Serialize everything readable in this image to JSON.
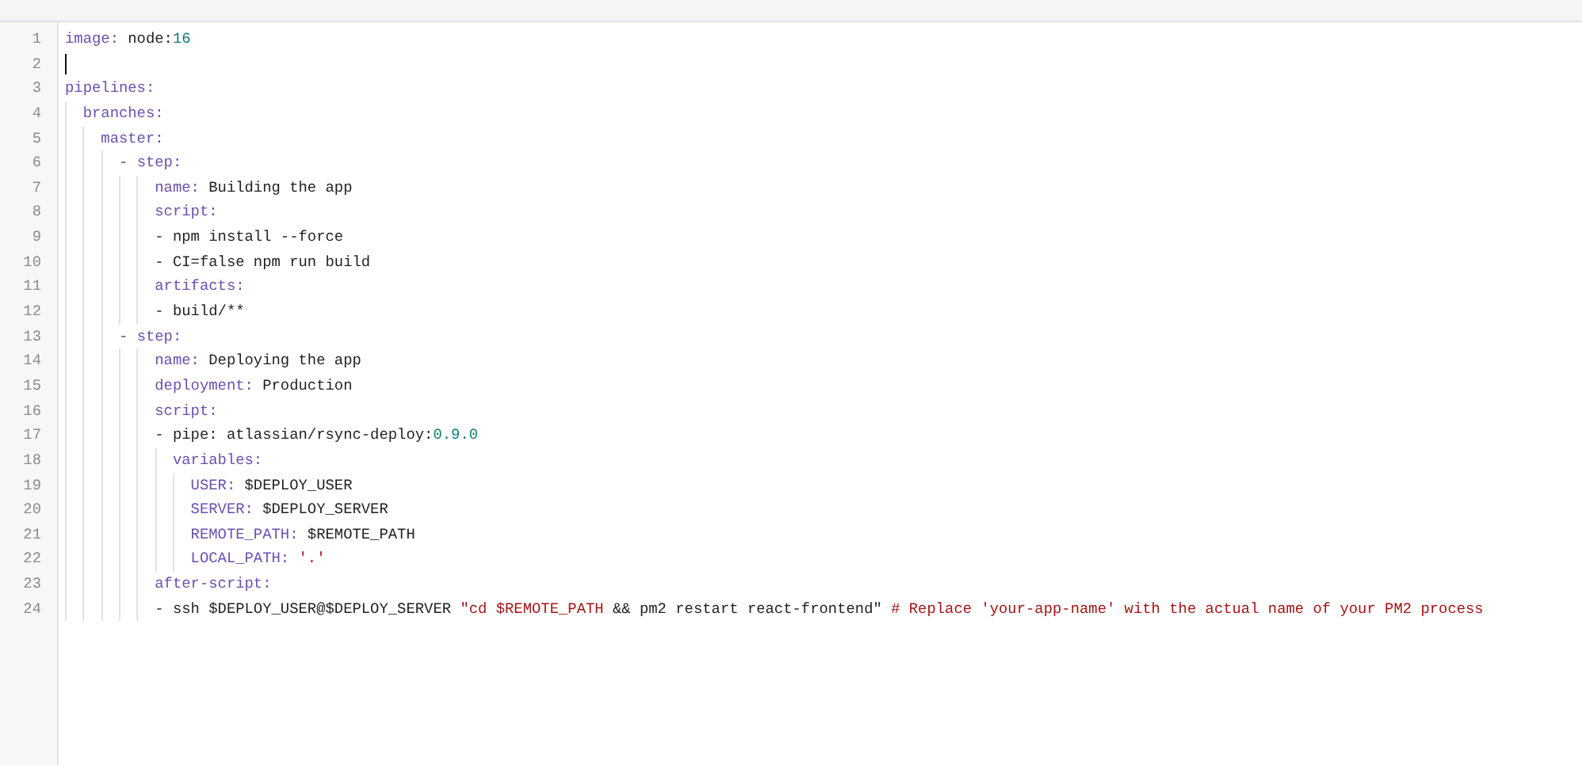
{
  "editor": {
    "lines": [
      {
        "number": "1",
        "cursor": false,
        "tokens": [
          {
            "kind": "key",
            "text": "image:"
          },
          {
            "kind": "plain",
            "text": " node:"
          },
          {
            "kind": "number",
            "text": "16"
          }
        ]
      },
      {
        "number": "2",
        "cursor": true
      },
      {
        "number": "3",
        "cursor": false,
        "tokens": [
          {
            "kind": "key",
            "text": "pipelines:"
          }
        ]
      },
      {
        "number": "4",
        "cursor": false,
        "tokens": [
          {
            "kind": "key",
            "text": "  branches:"
          }
        ]
      },
      {
        "number": "5",
        "cursor": false,
        "tokens": [
          {
            "kind": "key",
            "text": "    master:"
          }
        ]
      },
      {
        "number": "6",
        "cursor": false,
        "tokens": [
          {
            "kind": "punct",
            "text": "      - "
          },
          {
            "kind": "key",
            "text": "step:"
          }
        ]
      },
      {
        "number": "7",
        "cursor": false,
        "tokens": [
          {
            "kind": "key",
            "text": "          name:"
          },
          {
            "kind": "plain",
            "text": " Building the app"
          }
        ]
      },
      {
        "number": "8",
        "cursor": false,
        "tokens": [
          {
            "kind": "key",
            "text": "          script:"
          }
        ]
      },
      {
        "number": "9",
        "cursor": false,
        "tokens": [
          {
            "kind": "plain",
            "text": "          - npm install --force"
          }
        ]
      },
      {
        "number": "10",
        "cursor": false,
        "tokens": [
          {
            "kind": "plain",
            "text": "          - CI=false npm run build"
          }
        ]
      },
      {
        "number": "11",
        "cursor": false,
        "tokens": [
          {
            "kind": "key",
            "text": "          artifacts:"
          }
        ]
      },
      {
        "number": "12",
        "cursor": false,
        "tokens": [
          {
            "kind": "plain",
            "text": "          - build/**"
          }
        ]
      },
      {
        "number": "13",
        "cursor": false,
        "tokens": [
          {
            "kind": "punct",
            "text": "      - "
          },
          {
            "kind": "key",
            "text": "step:"
          }
        ]
      },
      {
        "number": "14",
        "cursor": false,
        "tokens": [
          {
            "kind": "key",
            "text": "          name:"
          },
          {
            "kind": "plain",
            "text": " Deploying the app"
          }
        ]
      },
      {
        "number": "15",
        "cursor": false,
        "tokens": [
          {
            "kind": "key",
            "text": "          deployment:"
          },
          {
            "kind": "plain",
            "text": " Production"
          }
        ]
      },
      {
        "number": "16",
        "cursor": false,
        "tokens": [
          {
            "kind": "key",
            "text": "          script:"
          }
        ]
      },
      {
        "number": "17",
        "cursor": false,
        "tokens": [
          {
            "kind": "plain",
            "text": "          - pipe: atlassian/rsync-deploy:"
          },
          {
            "kind": "number",
            "text": "0.9.0"
          }
        ]
      },
      {
        "number": "18",
        "cursor": false,
        "tokens": [
          {
            "kind": "key",
            "text": "            variables:"
          }
        ]
      },
      {
        "number": "19",
        "cursor": false,
        "tokens": [
          {
            "kind": "key",
            "text": "              USER:"
          },
          {
            "kind": "plain",
            "text": " $DEPLOY_USER"
          }
        ]
      },
      {
        "number": "20",
        "cursor": false,
        "tokens": [
          {
            "kind": "key",
            "text": "              SERVER:"
          },
          {
            "kind": "plain",
            "text": " $DEPLOY_SERVER"
          }
        ]
      },
      {
        "number": "21",
        "cursor": false,
        "tokens": [
          {
            "kind": "key",
            "text": "              REMOTE_PATH:"
          },
          {
            "kind": "plain",
            "text": " $REMOTE_PATH"
          }
        ]
      },
      {
        "number": "22",
        "cursor": false,
        "tokens": [
          {
            "kind": "key",
            "text": "              LOCAL_PATH:"
          },
          {
            "kind": "string",
            "text": " '.'"
          }
        ]
      },
      {
        "number": "23",
        "cursor": false,
        "tokens": [
          {
            "kind": "key",
            "text": "          after-script:"
          }
        ]
      },
      {
        "number": "24",
        "cursor": false,
        "tokens": [
          {
            "kind": "plain",
            "text": "          - ssh $DEPLOY_USER@$DEPLOY_SERVER "
          },
          {
            "kind": "string",
            "text": "\"cd $REMOTE_PATH"
          },
          {
            "kind": "plain",
            "text": " && pm2 restart react-frontend\" "
          },
          {
            "kind": "string",
            "text": "# Replace 'your-app-name' with the actual name of your PM2 process"
          }
        ]
      }
    ]
  }
}
